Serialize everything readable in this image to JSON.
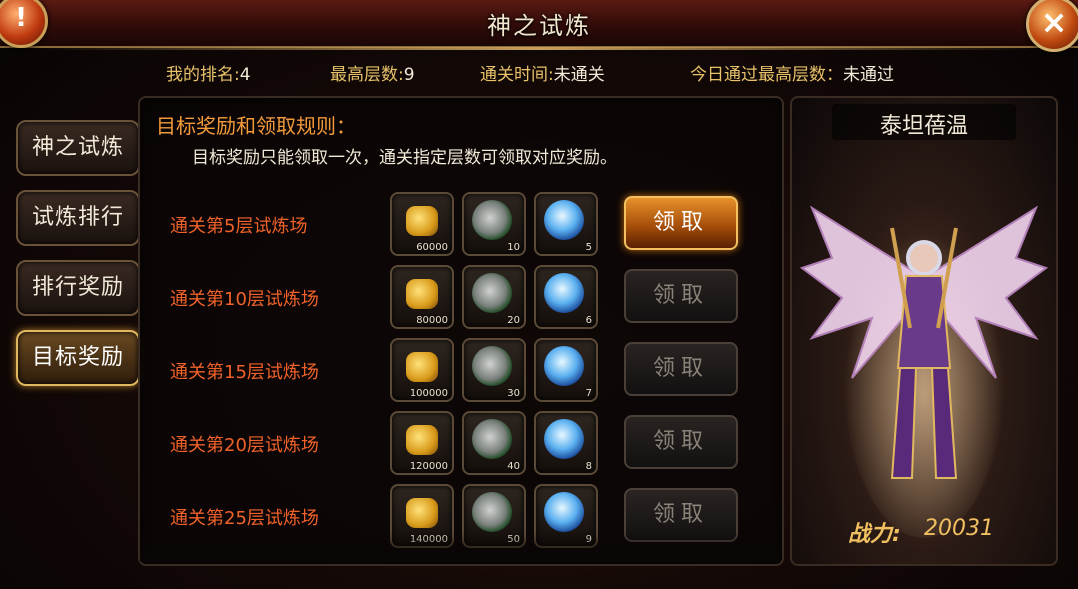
{
  "title": "神之试炼",
  "stats": {
    "rank_label": "我的排名:",
    "rank_value": "4",
    "max_layer_label": "最高层数:",
    "max_layer_value": "9",
    "clear_time_label": "通关时间:",
    "clear_time_value": "未通关",
    "today_label": "今日通过最高层数：",
    "today_value": "未通过"
  },
  "sidebar": [
    {
      "label": "神之试炼",
      "active": false
    },
    {
      "label": "试炼排行",
      "active": false
    },
    {
      "label": "排行奖励",
      "active": false
    },
    {
      "label": "目标奖励",
      "active": true
    }
  ],
  "rules": {
    "title": "目标奖励和领取规则：",
    "text": "目标奖励只能领取一次，通关指定层数可领取对应奖励。"
  },
  "rewards": [
    {
      "label": "通关第5层试炼场",
      "gold": "60000",
      "stone": "10",
      "crystal": "5",
      "claim": "领取",
      "claimable": true
    },
    {
      "label": "通关第10层试炼场",
      "gold": "80000",
      "stone": "20",
      "crystal": "6",
      "claim": "领取",
      "claimable": false
    },
    {
      "label": "通关第15层试炼场",
      "gold": "100000",
      "stone": "30",
      "crystal": "7",
      "claim": "领取",
      "claimable": false
    },
    {
      "label": "通关第20层试炼场",
      "gold": "120000",
      "stone": "40",
      "crystal": "8",
      "claim": "领取",
      "claimable": false
    },
    {
      "label": "通关第25层试炼场",
      "gold": "140000",
      "stone": "50",
      "crystal": "9",
      "claim": "领取",
      "claimable": false
    }
  ],
  "hero": {
    "name": "泰坦蓓温",
    "power_label": "战力:",
    "power_value": "20031"
  },
  "icons": {
    "warn": "!",
    "close": "×"
  },
  "colors": {
    "accent_orange": "#f0622a",
    "gold_text": "#e8c26a",
    "active_claim": "#e8902a"
  }
}
